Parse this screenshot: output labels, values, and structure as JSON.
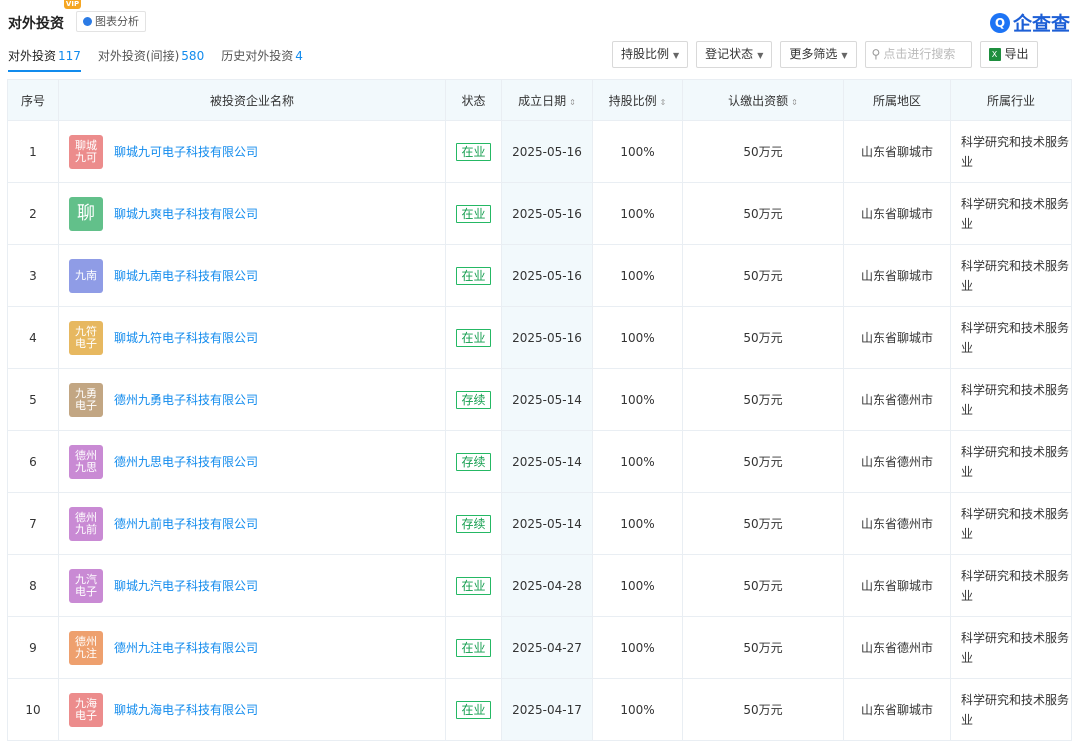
{
  "header": {
    "vip": "VIP",
    "title": "对外投资",
    "chart_button": "图表分析",
    "brand": "企查查"
  },
  "tabs": [
    {
      "label": "对外投资",
      "count": "117",
      "active": true
    },
    {
      "label": "对外投资(间接)",
      "count": "580",
      "active": false
    },
    {
      "label": "历史对外投资",
      "count": "4",
      "active": false
    }
  ],
  "toolbar": {
    "hold_ratio": "持股比例",
    "reg_status": "登记状态",
    "more_filters": "更多筛选",
    "search_placeholder": "点击进行搜索",
    "export": "导出"
  },
  "columns": [
    "序号",
    "被投资企业名称",
    "状态",
    "成立日期",
    "持股比例",
    "认缴出资额",
    "所属地区",
    "所属行业"
  ],
  "rows": [
    {
      "no": "1",
      "logo": "聊城九可",
      "logo_color": "#ec8c8c",
      "name": "聊城九可电子科技有限公司",
      "status": "在业",
      "date": "2025-05-16",
      "ratio": "100%",
      "capital": "50万元",
      "region": "山东省聊城市",
      "industry": "科学研究和技术服务业"
    },
    {
      "no": "2",
      "logo": "聊",
      "logo_color": "#62c08a",
      "name": "聊城九爽电子科技有限公司",
      "status": "在业",
      "date": "2025-05-16",
      "ratio": "100%",
      "capital": "50万元",
      "region": "山东省聊城市",
      "industry": "科学研究和技术服务业"
    },
    {
      "no": "3",
      "logo": "九南",
      "logo_color": "#8f9ce6",
      "name": "聊城九南电子科技有限公司",
      "status": "在业",
      "date": "2025-05-16",
      "ratio": "100%",
      "capital": "50万元",
      "region": "山东省聊城市",
      "industry": "科学研究和技术服务业"
    },
    {
      "no": "4",
      "logo": "九符电子",
      "logo_color": "#e7b860",
      "name": "聊城九符电子科技有限公司",
      "status": "在业",
      "date": "2025-05-16",
      "ratio": "100%",
      "capital": "50万元",
      "region": "山东省聊城市",
      "industry": "科学研究和技术服务业"
    },
    {
      "no": "5",
      "logo": "九勇电子",
      "logo_color": "#c2a683",
      "name": "德州九勇电子科技有限公司",
      "status": "存续",
      "date": "2025-05-14",
      "ratio": "100%",
      "capital": "50万元",
      "region": "山东省德州市",
      "industry": "科学研究和技术服务业"
    },
    {
      "no": "6",
      "logo": "德州九思",
      "logo_color": "#c98ad4",
      "name": "德州九思电子科技有限公司",
      "status": "存续",
      "date": "2025-05-14",
      "ratio": "100%",
      "capital": "50万元",
      "region": "山东省德州市",
      "industry": "科学研究和技术服务业"
    },
    {
      "no": "7",
      "logo": "德州九前",
      "logo_color": "#c98ad4",
      "name": "德州九前电子科技有限公司",
      "status": "存续",
      "date": "2025-05-14",
      "ratio": "100%",
      "capital": "50万元",
      "region": "山东省德州市",
      "industry": "科学研究和技术服务业"
    },
    {
      "no": "8",
      "logo": "九汽电子",
      "logo_color": "#c98ad4",
      "name": "聊城九汽电子科技有限公司",
      "status": "在业",
      "date": "2025-04-28",
      "ratio": "100%",
      "capital": "50万元",
      "region": "山东省聊城市",
      "industry": "科学研究和技术服务业"
    },
    {
      "no": "9",
      "logo": "德州九注",
      "logo_color": "#eea06e",
      "name": "德州九注电子科技有限公司",
      "status": "在业",
      "date": "2025-04-27",
      "ratio": "100%",
      "capital": "50万元",
      "region": "山东省德州市",
      "industry": "科学研究和技术服务业"
    },
    {
      "no": "10",
      "logo": "九海电子",
      "logo_color": "#ec8c8c",
      "name": "聊城九海电子科技有限公司",
      "status": "在业",
      "date": "2025-04-17",
      "ratio": "100%",
      "capital": "50万元",
      "region": "山东省聊城市",
      "industry": "科学研究和技术服务业"
    }
  ]
}
